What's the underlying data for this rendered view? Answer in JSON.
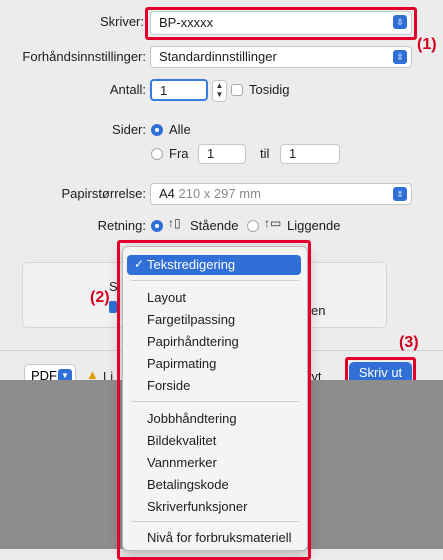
{
  "printer": {
    "label": "Skriver:",
    "value": "BP-xxxxx"
  },
  "presets": {
    "label": "Forhåndsinnstillinger:",
    "value": "Standardinnstillinger"
  },
  "copies": {
    "label": "Antall:",
    "value": "1",
    "duplex_label": "Tosidig"
  },
  "pages": {
    "label": "Sider:",
    "all_label": "Alle",
    "from_label": "Fra",
    "from_value": "1",
    "to_label": "til",
    "to_value": "1"
  },
  "paper": {
    "label": "Papirstørrelse:",
    "value": "A4",
    "dims": "210 x 297 mm"
  },
  "orientation": {
    "label": "Retning:",
    "portrait_label": "Stående",
    "landscape_label": "Liggende"
  },
  "callouts": {
    "one": "(1)",
    "two": "(2)",
    "three": "(3)"
  },
  "panel_fragments": {
    "left": "S",
    "right": "en"
  },
  "footer": {
    "pdf_label": "PDF",
    "warning_text": "Li",
    "cancel_fragment": "ryt",
    "print_label": "Skriv ut"
  },
  "menu": {
    "selected": "Tekstredigering",
    "group1": [
      "Layout",
      "Fargetilpassing",
      "Papirhåndtering",
      "Papirmating",
      "Forside"
    ],
    "group2": [
      "Jobbhåndtering",
      "Bildekvalitet",
      "Vannmerker",
      "Betalingskode",
      "Skriverfunksjoner"
    ],
    "group3": [
      "Nivå for forbruksmateriell"
    ]
  },
  "colors": {
    "accent": "#2f6fd6",
    "highlight_red": "#e0002a"
  },
  "icons": {
    "select_chevrons": "chevron-updown-icon",
    "checkmark": "checkmark-icon",
    "warning": "warning-icon"
  }
}
